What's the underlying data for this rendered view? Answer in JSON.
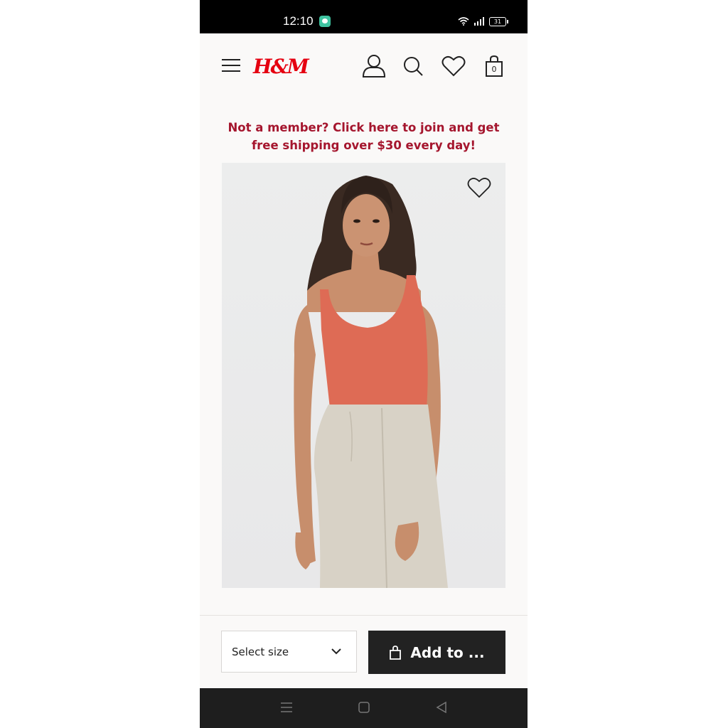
{
  "status_bar": {
    "time": "12:10",
    "battery": "31"
  },
  "header": {
    "logo": "H&M",
    "bag_count": "0"
  },
  "promo": {
    "text": "Not a member? Click here to join and get free shipping over $30 every day!"
  },
  "purchase_bar": {
    "size_placeholder": "Select size",
    "add_label": "Add to ..."
  },
  "icons": {
    "menu": "hamburger-icon",
    "account": "user-icon",
    "search": "search-icon",
    "favorites": "heart-icon",
    "bag": "shopping-bag-icon",
    "nav_recents": "recents-icon",
    "nav_home": "home-icon",
    "nav_back": "back-icon"
  },
  "colors": {
    "brand_red": "#e50010",
    "promo_red": "#a5162e",
    "button_dark": "#222222",
    "top_color": "#de6b55",
    "trousers_color": "#d8d2c6"
  }
}
